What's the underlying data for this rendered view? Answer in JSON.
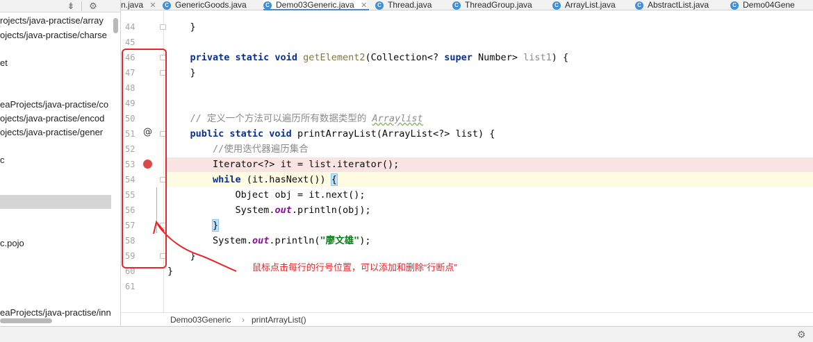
{
  "project_tree": {
    "items": [
      "rojects/java-practise/array",
      "ojects/java-practise/charse",
      "et",
      "eaProjects/java-practise/co",
      "ojects/java-practise/encod",
      "ojects/java-practise/gener",
      "c",
      "c.pojo",
      "eaProjects/java-practise/inn"
    ]
  },
  "tabs": [
    {
      "label": "n.java",
      "active": false
    },
    {
      "label": "GenericGoods.java",
      "active": false
    },
    {
      "label": "Demo03Generic.java",
      "active": true
    },
    {
      "label": "Thread.java",
      "active": false
    },
    {
      "label": "ThreadGroup.java",
      "active": false
    },
    {
      "label": "ArrayList.java",
      "active": false
    },
    {
      "label": "AbstractList.java",
      "active": false
    },
    {
      "label": "Demo04Gene",
      "active": false
    }
  ],
  "editor": {
    "line_numbers": [
      "44",
      "45",
      "46",
      "47",
      "48",
      "49",
      "50",
      "51",
      "52",
      "53",
      "54",
      "55",
      "56",
      "57",
      "58",
      "59",
      "60",
      "61"
    ],
    "override_marker": "@",
    "code": {
      "l44": "}",
      "l46_kw": "private static void ",
      "l46_name": "getElement2",
      "l46_sig": "(Collection<? ",
      "l46_super": "super",
      "l46_type": " Number> ",
      "l46_param": "list1",
      "l46_end": ") {",
      "l47": "}",
      "l50_comment": "// 定义一个方法可以遍历所有数据类型的 ",
      "l50_comment_ref": "Arraylist",
      "l51_kw": "public static void ",
      "l51_rest": "printArrayList(ArrayList<?> list) {",
      "l52_comment": "//使用迭代器遍历集合",
      "l53": "Iterator<?> it = list.iterator();",
      "l54_kw": "while",
      "l54_rest": " (it.hasNext()) ",
      "l54_brace": "{",
      "l55": "Object obj = it.next();",
      "l56_a": "System.",
      "l56_out": "out",
      "l56_b": ".println(obj);",
      "l57_brace": "}",
      "l58_a": "System.",
      "l58_out": "out",
      "l58_b": ".println(",
      "l58_str": "\"廖文雄\"",
      "l58_c": ");",
      "l59": "}",
      "l60": "}"
    }
  },
  "breadcrumb": {
    "class_name": "Demo03Generic",
    "separator": "›",
    "method_name": "printArrayList()"
  },
  "annotation": {
    "text": "鼠标点击每行的行号位置，可以添加和删除“行断点”",
    "color": "#e8262a"
  },
  "icons": {
    "toolbar": [
      "collapse-all-icon",
      "gear-icon"
    ],
    "tab_class_icon": "C",
    "status": "gear-icon"
  },
  "colors": {
    "breakpoint": "#db4848",
    "breakpoint_line": "#fae3e3",
    "caret_line": "#fdfbe1",
    "keyword": "#0b2f91",
    "string": "#067d17",
    "static_field": "#871094"
  }
}
